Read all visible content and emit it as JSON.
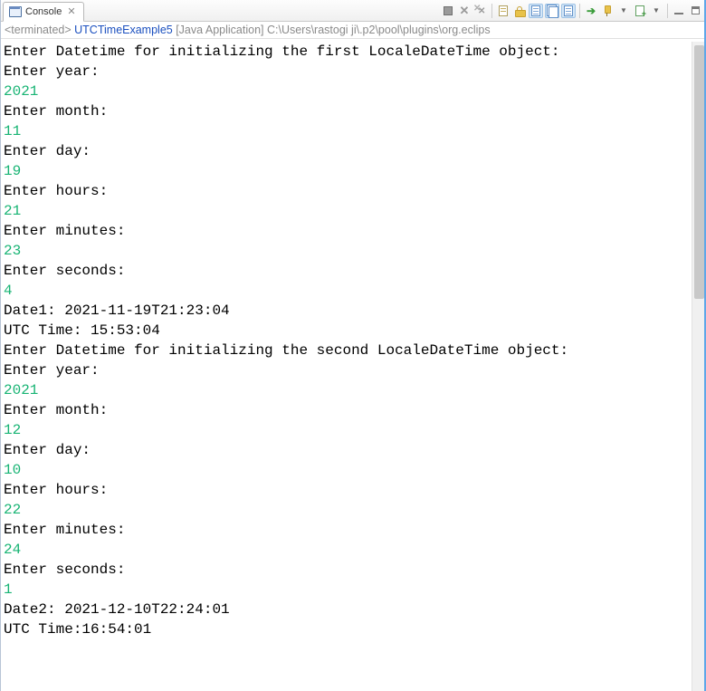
{
  "tab": {
    "title": "Console"
  },
  "status": {
    "prefix": "<terminated> ",
    "launch": "UTCTimeExample5",
    "type": " [Java Application]",
    "path": " C:\\Users\\rastogi ji\\.p2\\pool\\plugins\\org.eclips"
  },
  "console": {
    "lines": [
      {
        "t": "prompt",
        "v": "Enter Datetime for initializing the first LocaleDateTime object:"
      },
      {
        "t": "prompt",
        "v": "Enter year:"
      },
      {
        "t": "input",
        "v": "2021"
      },
      {
        "t": "prompt",
        "v": "Enter month:"
      },
      {
        "t": "input",
        "v": "11"
      },
      {
        "t": "prompt",
        "v": "Enter day:"
      },
      {
        "t": "input",
        "v": "19"
      },
      {
        "t": "prompt",
        "v": "Enter hours:"
      },
      {
        "t": "input",
        "v": "21"
      },
      {
        "t": "prompt",
        "v": "Enter minutes:"
      },
      {
        "t": "input",
        "v": "23"
      },
      {
        "t": "prompt",
        "v": "Enter seconds:"
      },
      {
        "t": "input",
        "v": "4"
      },
      {
        "t": "prompt",
        "v": "Date1: 2021-11-19T21:23:04"
      },
      {
        "t": "prompt",
        "v": "UTC Time: 15:53:04"
      },
      {
        "t": "prompt",
        "v": "Enter Datetime for initializing the second LocaleDateTime object:"
      },
      {
        "t": "prompt",
        "v": "Enter year:"
      },
      {
        "t": "input",
        "v": "2021"
      },
      {
        "t": "prompt",
        "v": "Enter month:"
      },
      {
        "t": "input",
        "v": "12"
      },
      {
        "t": "prompt",
        "v": "Enter day:"
      },
      {
        "t": "input",
        "v": "10"
      },
      {
        "t": "prompt",
        "v": "Enter hours:"
      },
      {
        "t": "input",
        "v": "22"
      },
      {
        "t": "prompt",
        "v": "Enter minutes:"
      },
      {
        "t": "input",
        "v": "24"
      },
      {
        "t": "prompt",
        "v": "Enter seconds:"
      },
      {
        "t": "input",
        "v": "1"
      },
      {
        "t": "prompt",
        "v": "Date2: 2021-12-10T22:24:01"
      },
      {
        "t": "prompt",
        "v": "UTC Time:16:54:01"
      }
    ]
  }
}
